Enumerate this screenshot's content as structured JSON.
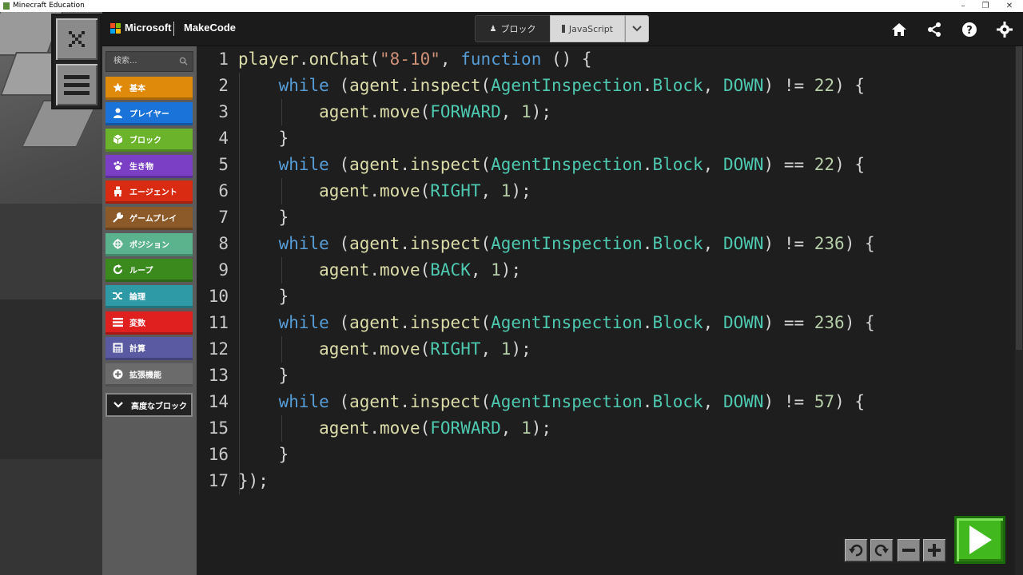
{
  "window": {
    "title": "Minecraft Education",
    "minimize": "–",
    "restore": "❐",
    "close": "✕"
  },
  "header": {
    "brand": "Microsoft",
    "product": "MakeCode",
    "tab_blocks": "ブロック",
    "tab_javascript": "JavaScript"
  },
  "toolbox": {
    "search_placeholder": "検索...",
    "categories": [
      {
        "label": "基本",
        "color": "#e08a0c"
      },
      {
        "label": "プレイヤー",
        "color": "#1a73d9"
      },
      {
        "label": "ブロック",
        "color": "#6ab32a"
      },
      {
        "label": "生き物",
        "color": "#7a3fc4"
      },
      {
        "label": "エージェント",
        "color": "#d92b12"
      },
      {
        "label": "ゲームプレイ",
        "color": "#8c5a28"
      },
      {
        "label": "ポジション",
        "color": "#5ab38c"
      },
      {
        "label": "ループ",
        "color": "#3a8a1e"
      },
      {
        "label": "論理",
        "color": "#2e9aa6"
      },
      {
        "label": "変数",
        "color": "#e01f1f"
      },
      {
        "label": "計算",
        "color": "#5a5aa3"
      },
      {
        "label": "拡張機能",
        "color": "#6b6b6b"
      }
    ],
    "advanced": "高度なブロック"
  },
  "editor": {
    "line_numbers": [
      "1",
      "2",
      "3",
      "4",
      "5",
      "6",
      "7",
      "8",
      "9",
      "10",
      "11",
      "12",
      "13",
      "14",
      "15",
      "16",
      "17"
    ],
    "lines": [
      [
        [
          "fn",
          "player"
        ],
        [
          "plain",
          "."
        ],
        [
          "fn",
          "onChat"
        ],
        [
          "plain",
          "("
        ],
        [
          "str",
          "\"8-10\""
        ],
        [
          "plain",
          ", "
        ],
        [
          "kw",
          "function"
        ],
        [
          "plain",
          " () {"
        ]
      ],
      [
        [
          "plain",
          "    "
        ],
        [
          "kw",
          "while"
        ],
        [
          "plain",
          " ("
        ],
        [
          "fn",
          "agent"
        ],
        [
          "plain",
          "."
        ],
        [
          "fn",
          "inspect"
        ],
        [
          "plain",
          "("
        ],
        [
          "cls",
          "AgentInspection"
        ],
        [
          "plain",
          "."
        ],
        [
          "cls",
          "Block"
        ],
        [
          "plain",
          ", "
        ],
        [
          "cls",
          "DOWN"
        ],
        [
          "plain",
          ") != "
        ],
        [
          "num",
          "22"
        ],
        [
          "plain",
          ") {"
        ]
      ],
      [
        [
          "plain",
          "        "
        ],
        [
          "fn",
          "agent"
        ],
        [
          "plain",
          "."
        ],
        [
          "fn",
          "move"
        ],
        [
          "plain",
          "("
        ],
        [
          "cls",
          "FORWARD"
        ],
        [
          "plain",
          ", "
        ],
        [
          "num",
          "1"
        ],
        [
          "plain",
          ");"
        ]
      ],
      [
        [
          "plain",
          "    }"
        ]
      ],
      [
        [
          "plain",
          "    "
        ],
        [
          "kw",
          "while"
        ],
        [
          "plain",
          " ("
        ],
        [
          "fn",
          "agent"
        ],
        [
          "plain",
          "."
        ],
        [
          "fn",
          "inspect"
        ],
        [
          "plain",
          "("
        ],
        [
          "cls",
          "AgentInspection"
        ],
        [
          "plain",
          "."
        ],
        [
          "cls",
          "Block"
        ],
        [
          "plain",
          ", "
        ],
        [
          "cls",
          "DOWN"
        ],
        [
          "plain",
          ") == "
        ],
        [
          "num",
          "22"
        ],
        [
          "plain",
          ") {"
        ]
      ],
      [
        [
          "plain",
          "        "
        ],
        [
          "fn",
          "agent"
        ],
        [
          "plain",
          "."
        ],
        [
          "fn",
          "move"
        ],
        [
          "plain",
          "("
        ],
        [
          "cls",
          "RIGHT"
        ],
        [
          "plain",
          ", "
        ],
        [
          "num",
          "1"
        ],
        [
          "plain",
          ");"
        ]
      ],
      [
        [
          "plain",
          "    }"
        ]
      ],
      [
        [
          "plain",
          "    "
        ],
        [
          "kw",
          "while"
        ],
        [
          "plain",
          " ("
        ],
        [
          "fn",
          "agent"
        ],
        [
          "plain",
          "."
        ],
        [
          "fn",
          "inspect"
        ],
        [
          "plain",
          "("
        ],
        [
          "cls",
          "AgentInspection"
        ],
        [
          "plain",
          "."
        ],
        [
          "cls",
          "Block"
        ],
        [
          "plain",
          ", "
        ],
        [
          "cls",
          "DOWN"
        ],
        [
          "plain",
          ") != "
        ],
        [
          "num",
          "236"
        ],
        [
          "plain",
          ") {"
        ]
      ],
      [
        [
          "plain",
          "        "
        ],
        [
          "fn",
          "agent"
        ],
        [
          "plain",
          "."
        ],
        [
          "fn",
          "move"
        ],
        [
          "plain",
          "("
        ],
        [
          "cls",
          "BACK"
        ],
        [
          "plain",
          ", "
        ],
        [
          "num",
          "1"
        ],
        [
          "plain",
          ");"
        ]
      ],
      [
        [
          "plain",
          "    }"
        ]
      ],
      [
        [
          "plain",
          "    "
        ],
        [
          "kw",
          "while"
        ],
        [
          "plain",
          " ("
        ],
        [
          "fn",
          "agent"
        ],
        [
          "plain",
          "."
        ],
        [
          "fn",
          "inspect"
        ],
        [
          "plain",
          "("
        ],
        [
          "cls",
          "AgentInspection"
        ],
        [
          "plain",
          "."
        ],
        [
          "cls",
          "Block"
        ],
        [
          "plain",
          ", "
        ],
        [
          "cls",
          "DOWN"
        ],
        [
          "plain",
          ") == "
        ],
        [
          "num",
          "236"
        ],
        [
          "plain",
          ") {"
        ]
      ],
      [
        [
          "plain",
          "        "
        ],
        [
          "fn",
          "agent"
        ],
        [
          "plain",
          "."
        ],
        [
          "fn",
          "move"
        ],
        [
          "plain",
          "("
        ],
        [
          "cls",
          "RIGHT"
        ],
        [
          "plain",
          ", "
        ],
        [
          "num",
          "1"
        ],
        [
          "plain",
          ");"
        ]
      ],
      [
        [
          "plain",
          "    }"
        ]
      ],
      [
        [
          "plain",
          "    "
        ],
        [
          "kw",
          "while"
        ],
        [
          "plain",
          " ("
        ],
        [
          "fn",
          "agent"
        ],
        [
          "plain",
          "."
        ],
        [
          "fn",
          "inspect"
        ],
        [
          "plain",
          "("
        ],
        [
          "cls",
          "AgentInspection"
        ],
        [
          "plain",
          "."
        ],
        [
          "cls",
          "Block"
        ],
        [
          "plain",
          ", "
        ],
        [
          "cls",
          "DOWN"
        ],
        [
          "plain",
          ") != "
        ],
        [
          "num",
          "57"
        ],
        [
          "plain",
          ") {"
        ]
      ],
      [
        [
          "plain",
          "        "
        ],
        [
          "fn",
          "agent"
        ],
        [
          "plain",
          "."
        ],
        [
          "fn",
          "move"
        ],
        [
          "plain",
          "("
        ],
        [
          "cls",
          "FORWARD"
        ],
        [
          "plain",
          ", "
        ],
        [
          "num",
          "1"
        ],
        [
          "plain",
          ");"
        ]
      ],
      [
        [
          "plain",
          "    }"
        ]
      ],
      [
        [
          "plain",
          "});"
        ]
      ]
    ]
  },
  "colors": {
    "run_button": "#41b91e",
    "editor_bg": "#1e1e1e",
    "header_bg": "#1b1b1b"
  }
}
